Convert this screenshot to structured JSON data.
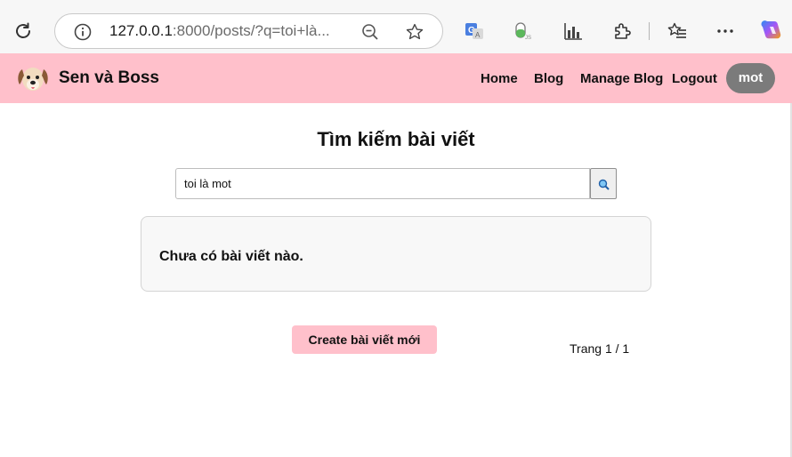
{
  "browser": {
    "url_host": "127.0.0.1",
    "url_path": ":8000/posts/?q=toi+là..."
  },
  "header": {
    "brand": "Sen và Boss",
    "nav": [
      "Home",
      "Blog",
      "Manage Blog",
      "Logout"
    ],
    "user": "mot"
  },
  "main": {
    "title": "Tìm kiếm bài viết",
    "search_value": "toi là mot",
    "empty_message": "Chưa có bài viết nào.",
    "create_button": "Create bài viết mới",
    "pagination": "Trang 1 / 1"
  },
  "colors": {
    "header_bg": "#ffc0cb",
    "user_pill_bg": "#7b7b7b"
  },
  "icons": {
    "toolbar": [
      "reload-icon",
      "info-icon",
      "zoom-out-icon",
      "star-icon",
      "translate-icon",
      "js-extension-icon",
      "chart-extension-icon",
      "puzzle-icon",
      "favorites-icon",
      "more-icon",
      "copilot-icon"
    ],
    "site": [
      "dog-logo-icon",
      "search-icon"
    ]
  }
}
